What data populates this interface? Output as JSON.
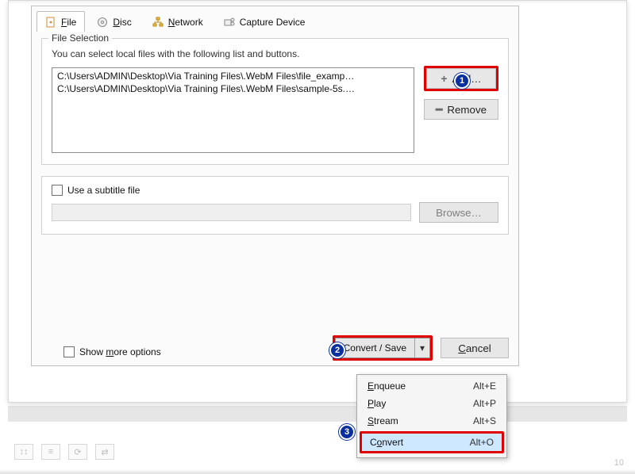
{
  "tabs": {
    "file": "File",
    "disc": "Disc",
    "network": "Network",
    "capture": "Capture Device"
  },
  "fileSelection": {
    "legend": "File Selection",
    "hint": "You can select local files with the following list and buttons.",
    "files": [
      "C:\\Users\\ADMIN\\Desktop\\Via Training Files\\.WebM Files\\file_examp…",
      "C:\\Users\\ADMIN\\Desktop\\Via Training Files\\.WebM Files\\sample-5s.…"
    ],
    "add": "Add…",
    "remove": "Remove"
  },
  "subtitle": {
    "useLabel": "Use a subtitle file",
    "browse": "Browse…"
  },
  "more": "Show more options",
  "footer": {
    "convertSave": "Convert / Save",
    "cancel": "Cancel"
  },
  "menu": {
    "enqueue": {
      "label": "Enqueue",
      "shortcut": "Alt+E"
    },
    "play": {
      "label": "Play",
      "shortcut": "Alt+P"
    },
    "stream": {
      "label": "Stream",
      "shortcut": "Alt+S"
    },
    "convert": {
      "label": "Convert",
      "shortcut": "Alt+O"
    }
  },
  "pageNumber": "10"
}
